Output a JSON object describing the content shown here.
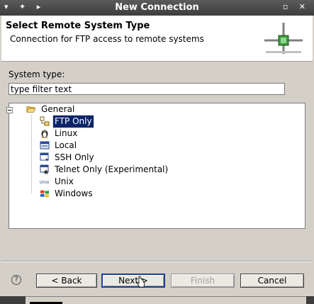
{
  "window": {
    "title": "New Connection",
    "left_controls": "▾ ✦ ▸",
    "right_controls": "▫ ✕"
  },
  "header": {
    "title": "Select Remote System Type",
    "description": "Connection for FTP access to remote systems"
  },
  "form": {
    "system_type_label": "System type:",
    "filter_value": "type filter text"
  },
  "tree": {
    "root": {
      "label": "General",
      "icon": "folder-open-icon",
      "expanded": true
    },
    "items": [
      {
        "label": "FTP Only",
        "icon": "ftp-icon",
        "selected": true
      },
      {
        "label": "Linux",
        "icon": "penguin-icon",
        "selected": false
      },
      {
        "label": "Local",
        "icon": "local-system-icon",
        "selected": false
      },
      {
        "label": "SSH Only",
        "icon": "ssh-icon",
        "selected": false
      },
      {
        "label": "Telnet Only (Experimental)",
        "icon": "telnet-icon",
        "selected": false
      },
      {
        "label": "Unix",
        "icon": "unix-icon",
        "selected": false
      },
      {
        "label": "Windows",
        "icon": "windows-icon",
        "selected": false
      }
    ]
  },
  "buttons": {
    "help": "?",
    "back": "< Back",
    "next": "Next >",
    "finish": "Finish",
    "cancel": "Cancel"
  },
  "colors": {
    "selection": "#0a246a",
    "titlebar": "#4a4a4a",
    "dialog_bg": "#d4d0c8"
  }
}
